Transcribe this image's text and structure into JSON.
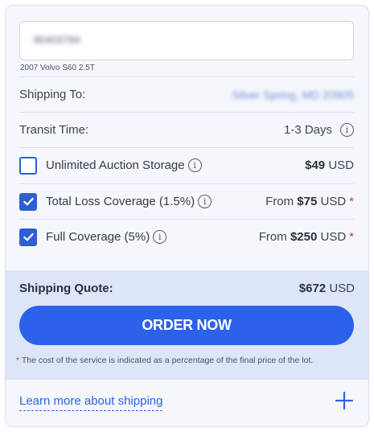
{
  "lot": {
    "id": "80403784",
    "vehicle": "2007 Volvo S60 2.5T"
  },
  "shipping_to": {
    "label": "Shipping To:",
    "value": "Silver Spring, MD 20905"
  },
  "transit": {
    "label": "Transit Time:",
    "value": "1-3 Days"
  },
  "options": [
    {
      "label": "Unlimited Auction Storage",
      "checked": false,
      "price_prefix": "",
      "price": "$49",
      "currency": "USD",
      "asterisk": ""
    },
    {
      "label": "Total Loss Coverage (1.5%)",
      "checked": true,
      "price_prefix": "From ",
      "price": "$75",
      "currency": "USD",
      "asterisk": "*"
    },
    {
      "label": "Full Coverage (5%)",
      "checked": true,
      "price_prefix": "From ",
      "price": "$250",
      "currency": "USD",
      "asterisk": "*"
    }
  ],
  "quote": {
    "label": "Shipping Quote:",
    "amount": "$672",
    "currency": "USD"
  },
  "order_button": "ORDER NOW",
  "footnote": {
    "star": "*",
    "text": "The cost of the service is indicated as a percentage of the final price of the lot."
  },
  "learn_more": "Learn more about shipping",
  "info_glyph": "i",
  "colors": {
    "accent": "#2c62e9",
    "asterisk": "#d9363e",
    "quote_bg": "#dde5f8",
    "card_bg": "#f5f7fc"
  }
}
